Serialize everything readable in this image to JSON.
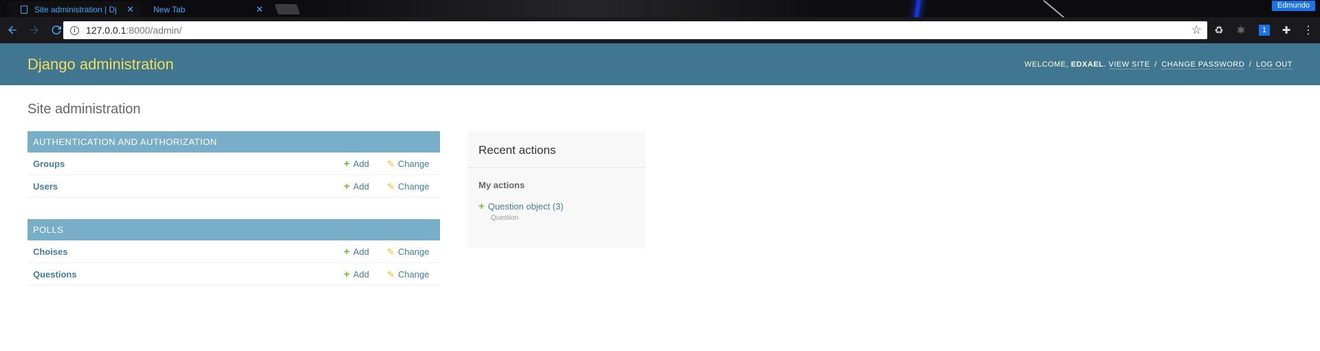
{
  "browser": {
    "tabs": [
      {
        "title": "Site administration | Dj",
        "active": true
      },
      {
        "title": "New Tab",
        "active": false
      }
    ],
    "close_glyph": "✕",
    "profile_name": "Edmundo",
    "url_host": "127.0.0.1",
    "url_path": ":8000/admin/",
    "extension_badge": "1",
    "icons": [
      "back-icon",
      "forward-icon",
      "reload-icon",
      "info-icon",
      "star-icon",
      "recycle-icon",
      "react-icon",
      "onepassword-icon",
      "puzzle-icon",
      "menu-icon"
    ]
  },
  "header": {
    "branding": "Django administration",
    "welcome": "WELCOME, ",
    "username": "EDXAEL",
    "welcome_suffix": ".",
    "view_site": "VIEW SITE",
    "change_password": "CHANGE PASSWORD",
    "log_out": "LOG OUT",
    "separator": "/"
  },
  "content": {
    "title": "Site administration",
    "modules": [
      {
        "caption": "AUTHENTICATION AND AUTHORIZATION",
        "models": [
          {
            "name": "Groups",
            "add": "Add",
            "change": "Change"
          },
          {
            "name": "Users",
            "add": "Add",
            "change": "Change"
          }
        ]
      },
      {
        "caption": "POLLS",
        "models": [
          {
            "name": "Choises",
            "add": "Add",
            "change": "Change"
          },
          {
            "name": "Questions",
            "add": "Add",
            "change": "Change"
          }
        ]
      }
    ],
    "recent_actions": {
      "title": "Recent actions",
      "subtitle": "My actions",
      "items": [
        {
          "label": "Question object (3)",
          "type": "Question",
          "action": "add"
        }
      ]
    }
  },
  "colors": {
    "header_bg": "#417690",
    "branding": "#f5dd5d",
    "caption_bg": "#79aec8",
    "link": "#447e9b",
    "add_icon": "#70bf2b",
    "change_icon": "#efb80b"
  }
}
